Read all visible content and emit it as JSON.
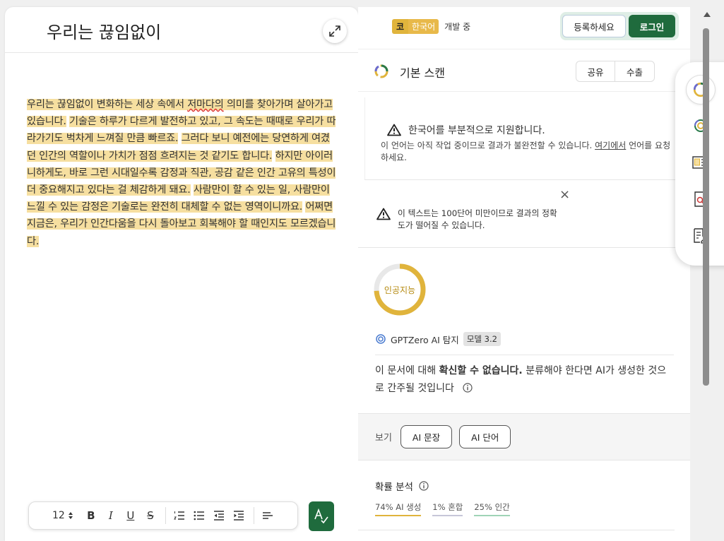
{
  "editor": {
    "title": "우리는 끊임없이",
    "segments": [
      {
        "text": "우리는 끊임없이 변화하는 세상 속에서 ",
        "hl": true
      },
      {
        "text": "저마다의",
        "hl": true,
        "err": true
      },
      {
        "text": " 의미를 찾아가며 살아가고 있습니다.",
        "hl": true
      },
      {
        "text": " ",
        "hl": false
      },
      {
        "text": "기술은 하루가 다르게 발전하고 있고, 그 속도는 때때로 우리가 따라가기도 벅차게 느껴질 만큼 빠르죠.",
        "hl": true
      },
      {
        "text": " ",
        "hl": false
      },
      {
        "text": "그러다 보니 예전에는 당연하게 여겼던 인간의 역할이나 가치가 점점 흐려지는 것 같기도 합니다.",
        "hl": true
      },
      {
        "text": " ",
        "hl": false
      },
      {
        "text": "하지만 아이러니하게도, 바로 그런 시대일수록 감정과 직관, 공감 같은 인간 고유의 특성이 더 중요해지고 있다는 걸 체감하게 돼요.",
        "hl": true
      },
      {
        "text": " ",
        "hl": false
      },
      {
        "text": "사람만이 할 수 있는 일, 사람만이 느낄 수 있는 감정은 기술로는 완전히 대체할 수 없는 영역이니까요.",
        "hl": true
      },
      {
        "text": " ",
        "hl": false
      },
      {
        "text": "어쩌면 지금은, 우리가 인간다움을 다시 돌아보고 회복해야 할 때인지도 모르겠습니다.",
        "hl": true
      }
    ],
    "toolbar": {
      "font_size": "12",
      "bold": "B",
      "italic": "I",
      "underline": "U",
      "strike": "S"
    }
  },
  "topbar": {
    "lang_code": "코",
    "lang_name": "한국어",
    "lang_status": "개발 중",
    "signup": "등록하세요",
    "login": "로그인"
  },
  "scan": {
    "title": "기본 스캔",
    "share": "공유",
    "export": "수출"
  },
  "notice1": {
    "title": "한국어를 부분적으로 지원합니다.",
    "body_before": "이 언어는 아직 작업 중이므로 결과가 불완전할 수 있습니다. ",
    "link": "여기에서",
    "body_after": " 언어를 요청하세요.",
    "close": "×"
  },
  "notice2": {
    "close": "×",
    "line1": "이 텍스트는 100단어 미만이므로 결과의 정확",
    "line2": "도가 떨어질 수 있습니다."
  },
  "result": {
    "ring_label": "인공지능",
    "ring_percent": 74,
    "detector": "GPTZero AI 탐지",
    "model": "모델 3.2",
    "verdict_before": "이 문서에 대해 ",
    "verdict_bold": "확신할 수 없습니다.",
    "verdict_after": " 분류해야 한다면 AI가 생성한 것으로 간주될 것입니다"
  },
  "view": {
    "label": "보기",
    "btn_sentence": "AI 문장",
    "btn_word": "AI 단어"
  },
  "prob": {
    "title": "확률 분석",
    "ai": "74% AI 생성",
    "mixed": "1% 혼합",
    "human": "25% 인간"
  },
  "colors": {
    "brand_green": "#1f6b3d",
    "ai_yellow": "#e0b43c",
    "highlight": "#f6dfa0"
  }
}
